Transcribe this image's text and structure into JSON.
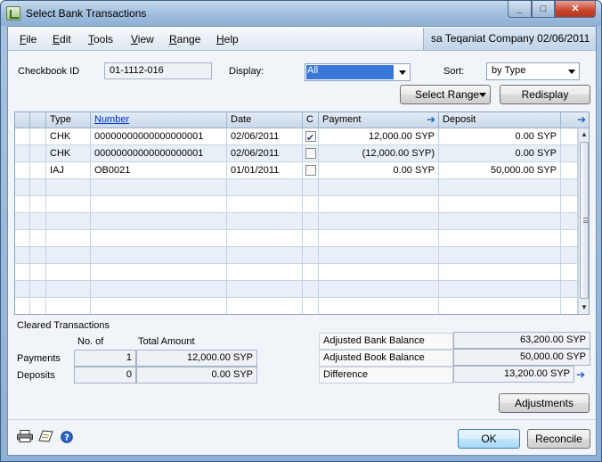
{
  "window": {
    "title": "Select Bank Transactions"
  },
  "menu": {
    "items": [
      "File",
      "Edit",
      "Tools",
      "View",
      "Range",
      "Help"
    ],
    "mnemonics": [
      "F",
      "E",
      "T",
      "V",
      "R",
      "H"
    ],
    "company": "sa  Teqaniat Company  02/06/2011"
  },
  "filters": {
    "checkbook_label": "Checkbook ID",
    "checkbook_value": "01-1112-016",
    "display_label": "Display:",
    "display_value": "All",
    "sort_label": "Sort:",
    "sort_value": "by Type"
  },
  "buttons": {
    "select_range": "Select Range",
    "redisplay": "Redisplay",
    "adjustments": "Adjustments",
    "ok": "OK",
    "reconcile": "Reconcile"
  },
  "grid": {
    "headers": {
      "type": "Type",
      "number": "Number",
      "date": "Date",
      "cleared": "C",
      "payment": "Payment",
      "deposit": "Deposit"
    },
    "rows": [
      {
        "type": "CHK",
        "number": "00000000000000000001",
        "date": "02/06/2011",
        "cleared": true,
        "payment": "12,000.00 SYP",
        "deposit": "0.00 SYP"
      },
      {
        "type": "CHK",
        "number": "00000000000000000001",
        "date": "02/06/2011",
        "cleared": false,
        "payment": "(12,000.00 SYP)",
        "deposit": "0.00 SYP"
      },
      {
        "type": "IAJ",
        "number": "OB0021",
        "date": "01/01/2011",
        "cleared": false,
        "payment": "0.00 SYP",
        "deposit": "50,000.00 SYP"
      }
    ],
    "empty_rows": 8
  },
  "cleared": {
    "title": "Cleared Transactions",
    "no_of_label": "No. of",
    "total_amount_label": "Total Amount",
    "payments_label": "Payments",
    "payments_count": "1",
    "payments_total": "12,000.00 SYP",
    "deposits_label": "Deposits",
    "deposits_count": "0",
    "deposits_total": "0.00 SYP"
  },
  "balances": {
    "adjusted_bank_label": "Adjusted Bank Balance",
    "adjusted_bank_value": "63,200.00 SYP",
    "adjusted_book_label": "Adjusted Book Balance",
    "adjusted_book_value": "50,000.00 SYP",
    "difference_label": "Difference",
    "difference_value": "13,200.00 SYP"
  },
  "colors": {
    "selection": "#3778d8",
    "link": "#0033cc",
    "arrow": "#1f5fbf"
  }
}
